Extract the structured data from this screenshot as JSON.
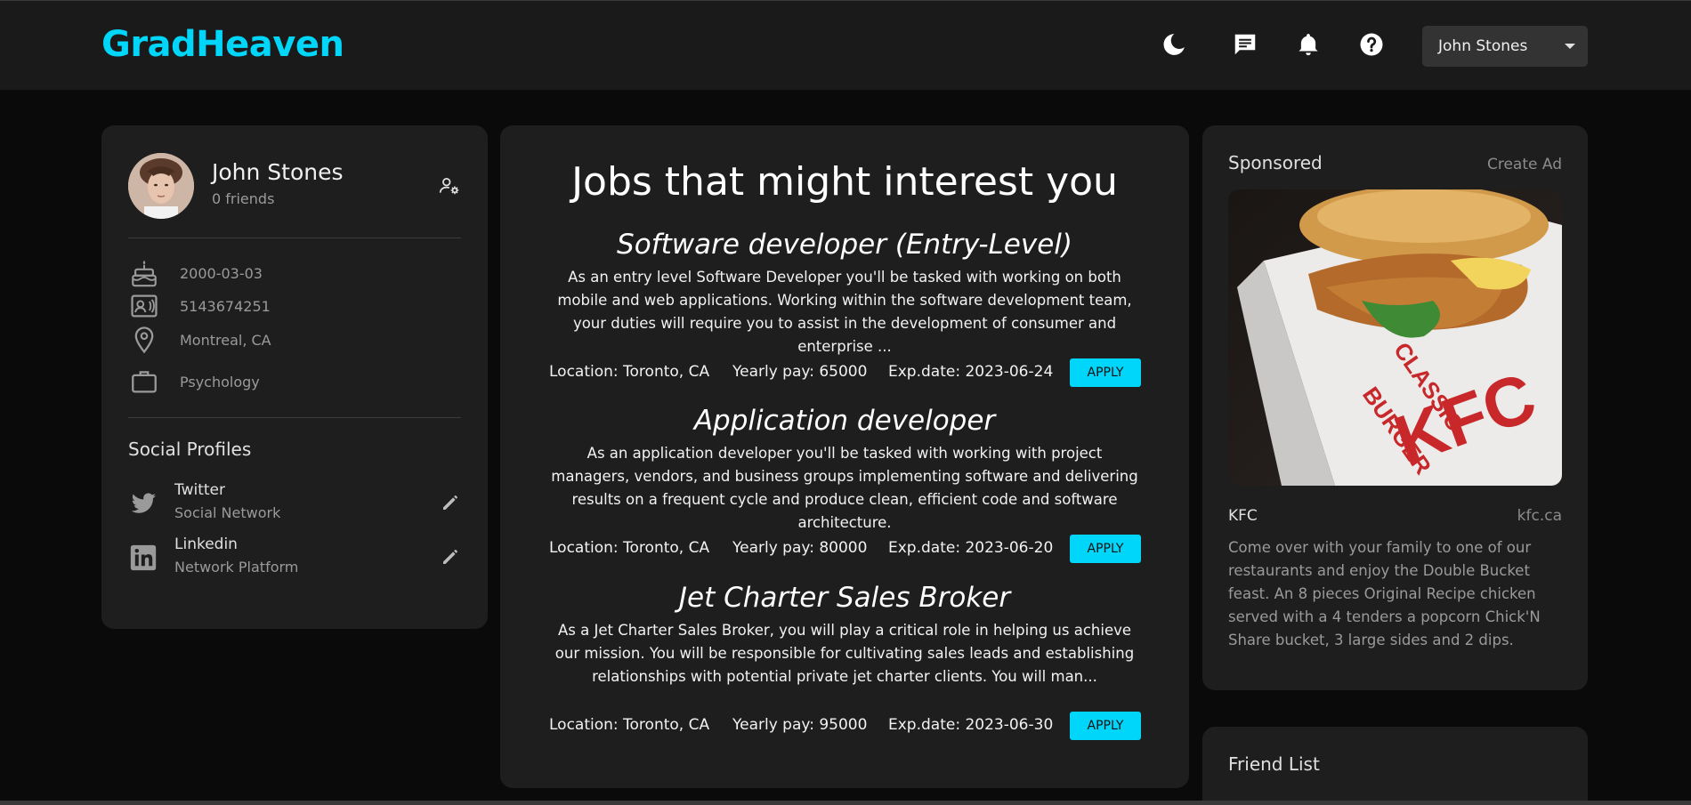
{
  "header": {
    "brand": "GradHeaven",
    "user_menu": "John Stones"
  },
  "colors": {
    "accent": "#00d5fa",
    "background": "#0a0a0a",
    "card": "#1e1e1e"
  },
  "icons": [
    "moon-icon",
    "message-icon",
    "bell-icon",
    "help-icon"
  ],
  "profile": {
    "name": "John Stones",
    "friends": "0 friends",
    "birthday": "2000-03-03",
    "phone": "5143674251",
    "location": "Montreal, CA",
    "occupation": "Psychology",
    "social_title": "Social Profiles",
    "socials": [
      {
        "name": "Twitter",
        "type": "Social Network"
      },
      {
        "name": "Linkedin",
        "type": "Network Platform"
      }
    ]
  },
  "jobs": {
    "heading": "Jobs that might interest you",
    "items": [
      {
        "title": "Software developer (Entry-Level)",
        "description": "As an entry level Software Developer you'll be tasked with working on both mobile and web applications. Working within the software development team, your duties will require you to assist in the development of consumer and enterprise ...",
        "location": "Location: Toronto, CA",
        "pay": "Yearly pay: 65000",
        "expiry": "Exp.date: 2023-06-24",
        "apply": "APPLY"
      },
      {
        "title": "Application developer",
        "description": "As an application developer you'll be tasked with working with project managers, vendors, and business groups implementing software and delivering results on a frequent cycle and produce clean, efficient code and software architecture.",
        "location": "Location: Toronto, CA",
        "pay": "Yearly pay: 80000",
        "expiry": "Exp.date: 2023-06-20",
        "apply": "APPLY"
      },
      {
        "title": "Jet Charter Sales Broker",
        "description": "As a Jet Charter Sales Broker, you will play a critical role in helping us achieve our mission. You will be responsible for cultivating sales leads and establishing relationships with potential private jet charter clients. You will man...",
        "location": "Location: Toronto, CA",
        "pay": "Yearly pay: 95000",
        "expiry": "Exp.date: 2023-06-30",
        "apply": "APPLY"
      }
    ]
  },
  "ad": {
    "heading": "Sponsored",
    "create": "Create Ad",
    "brand": "KFC",
    "link": "kfc.ca",
    "description": "Come over with your family to one of our restaurants and enjoy the Double Bucket feast. An 8 pieces Original Recipe chicken served with a 4 tenders a popcorn Chick'N Share bucket, 3 large sides and 2 dips.",
    "image_text_1": "CLASSIC",
    "image_text_2": "BURGER",
    "image_text_3": "KFC"
  },
  "friends": {
    "heading": "Friend List"
  }
}
